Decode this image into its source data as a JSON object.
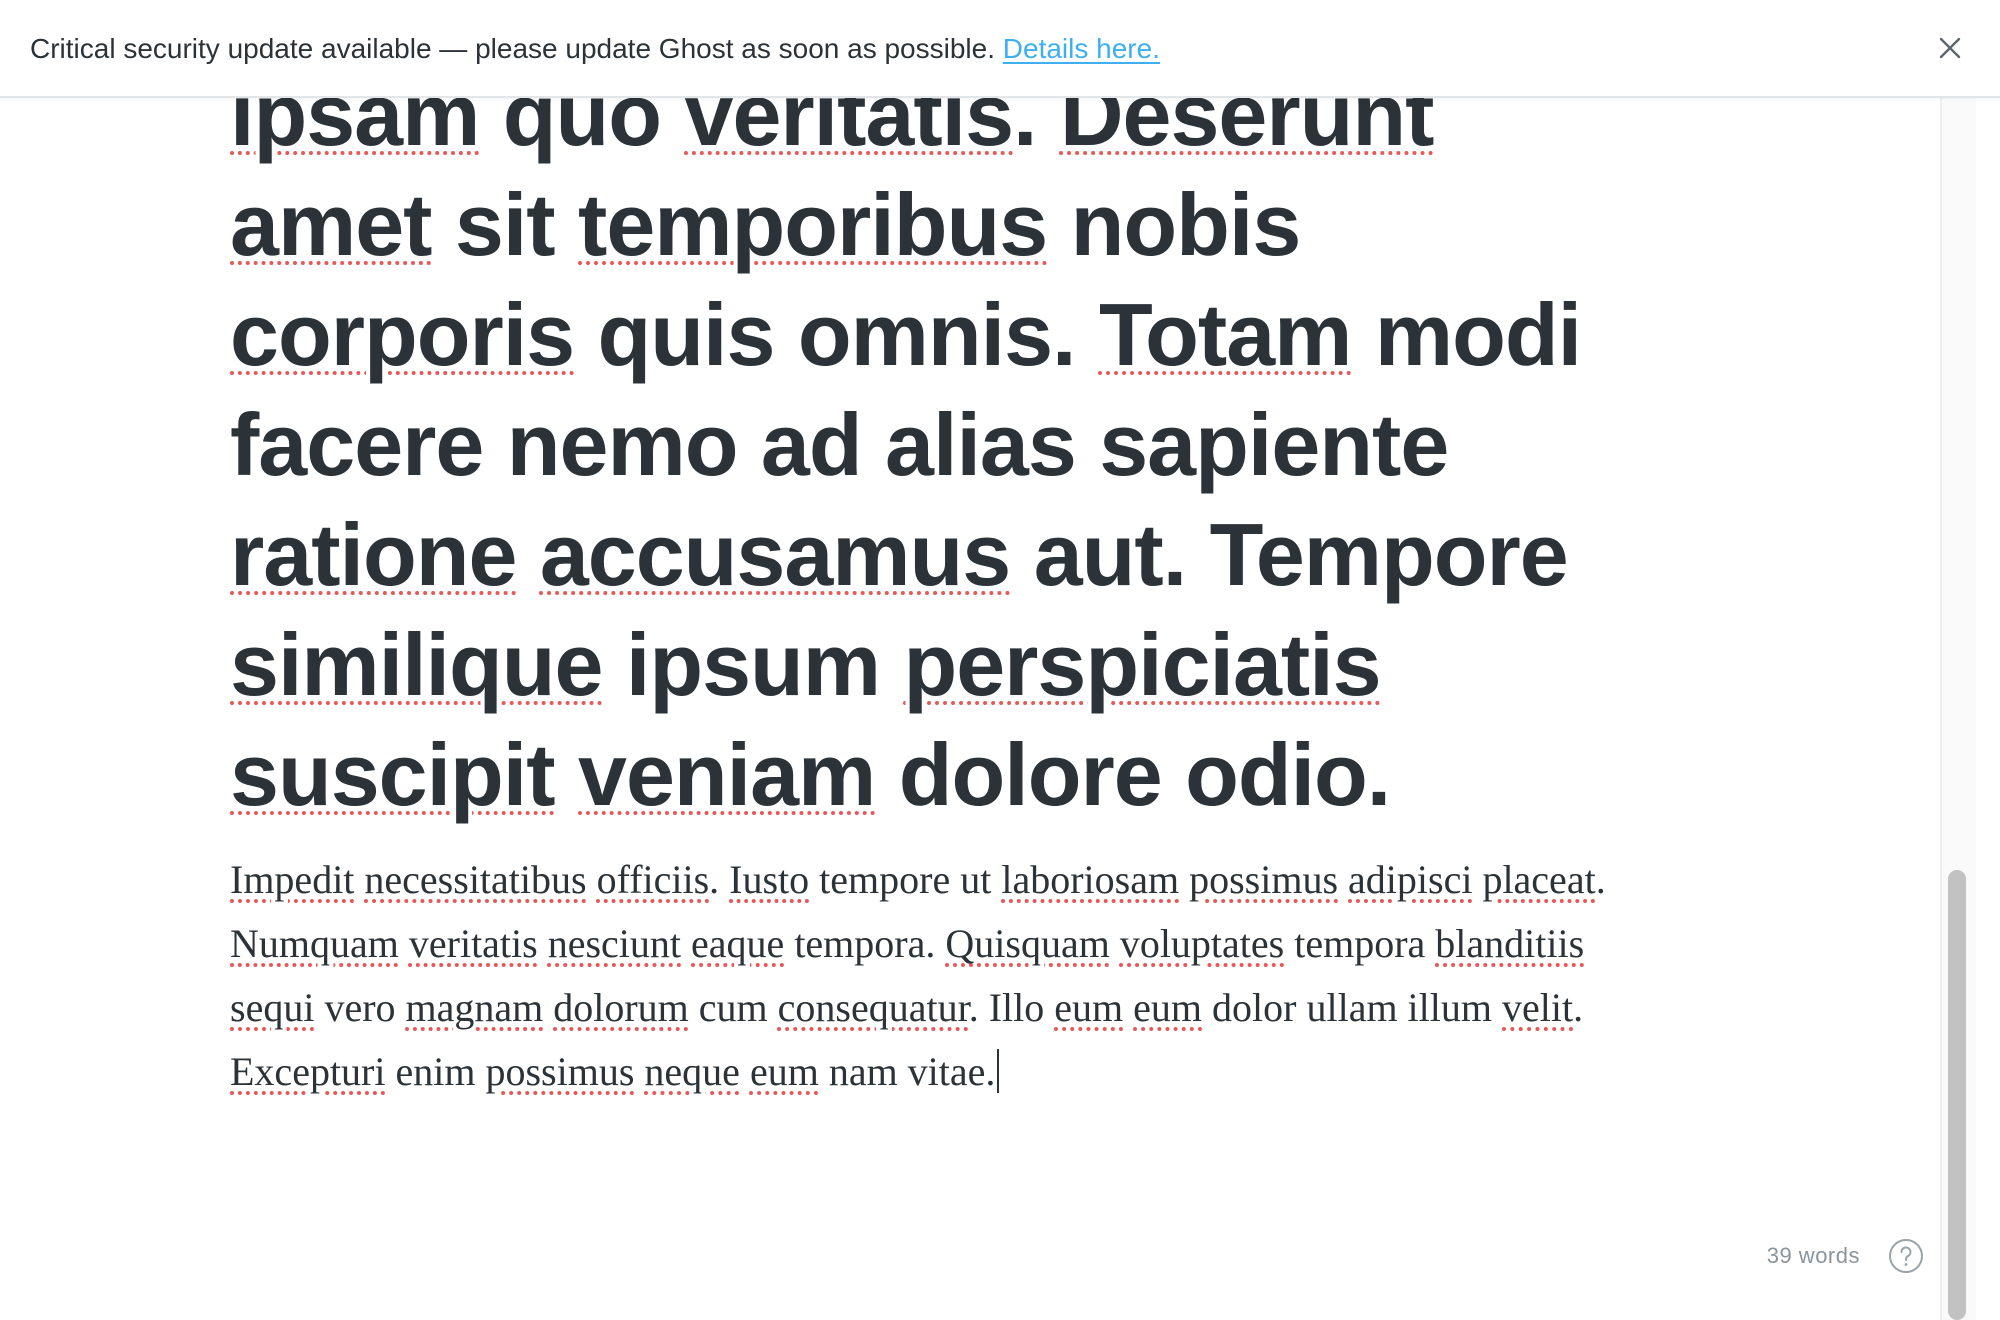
{
  "banner": {
    "message": "Critical security update available — please update Ghost as soon as possible.",
    "link_label": "Details here.",
    "link_color": "#3eb0ef"
  },
  "editor": {
    "title_segments": [
      {
        "text": "ipsam",
        "misspelled": true
      },
      {
        "text": " "
      },
      {
        "text": "quo"
      },
      {
        "text": " "
      },
      {
        "text": "veritatis",
        "misspelled": true
      },
      {
        "text": ". "
      },
      {
        "text": "Deserunt",
        "misspelled": true
      },
      {
        "text": " "
      },
      {
        "text": "amet",
        "misspelled": true
      },
      {
        "text": " sit "
      },
      {
        "text": "temporibus",
        "misspelled": true
      },
      {
        "text": " nobis "
      },
      {
        "text": "corporis",
        "misspelled": true
      },
      {
        "text": " quis omnis. "
      },
      {
        "text": "Totam",
        "misspelled": true
      },
      {
        "text": " modi facere nemo ad alias sapiente "
      },
      {
        "text": "ratione",
        "misspelled": true
      },
      {
        "text": " "
      },
      {
        "text": "accusamus",
        "misspelled": true
      },
      {
        "text": " aut. Tempore "
      },
      {
        "text": "similique",
        "misspelled": true
      },
      {
        "text": " ipsum "
      },
      {
        "text": "perspiciatis",
        "misspelled": true
      },
      {
        "text": " "
      },
      {
        "text": "suscipit",
        "misspelled": true
      },
      {
        "text": " "
      },
      {
        "text": "veniam",
        "misspelled": true
      },
      {
        "text": " dolore odio."
      }
    ],
    "body_segments": [
      {
        "text": "Impedit",
        "misspelled": true
      },
      {
        "text": " "
      },
      {
        "text": "necessitatibus",
        "misspelled": true
      },
      {
        "text": " "
      },
      {
        "text": "officiis",
        "misspelled": true
      },
      {
        "text": ". "
      },
      {
        "text": "Iusto",
        "misspelled": true
      },
      {
        "text": " tempore ut "
      },
      {
        "text": "laboriosam",
        "misspelled": true
      },
      {
        "text": " "
      },
      {
        "text": "possimus",
        "misspelled": true
      },
      {
        "text": " "
      },
      {
        "text": "adipisci",
        "misspelled": true
      },
      {
        "text": " "
      },
      {
        "text": "placeat",
        "misspelled": true
      },
      {
        "text": ". "
      },
      {
        "text": "Numquam",
        "misspelled": true
      },
      {
        "text": " "
      },
      {
        "text": "veritatis",
        "misspelled": true
      },
      {
        "text": " "
      },
      {
        "text": "nesciunt",
        "misspelled": true
      },
      {
        "text": " "
      },
      {
        "text": "eaque",
        "misspelled": true
      },
      {
        "text": " tempora. "
      },
      {
        "text": "Quisquam",
        "misspelled": true
      },
      {
        "text": " "
      },
      {
        "text": "voluptates",
        "misspelled": true
      },
      {
        "text": " tempora "
      },
      {
        "text": "blanditiis",
        "misspelled": true
      },
      {
        "text": " "
      },
      {
        "text": "sequi",
        "misspelled": true
      },
      {
        "text": " vero "
      },
      {
        "text": "magnam",
        "misspelled": true
      },
      {
        "text": " "
      },
      {
        "text": "dolorum",
        "misspelled": true
      },
      {
        "text": " cum "
      },
      {
        "text": "consequatur",
        "misspelled": true
      },
      {
        "text": ". Illo "
      },
      {
        "text": "eum",
        "misspelled": true
      },
      {
        "text": " "
      },
      {
        "text": "eum",
        "misspelled": true
      },
      {
        "text": " dolor ullam illum "
      },
      {
        "text": "velit",
        "misspelled": true
      },
      {
        "text": ". "
      },
      {
        "text": "Excepturi",
        "misspelled": true
      },
      {
        "text": " enim "
      },
      {
        "text": "possimus",
        "misspelled": true
      },
      {
        "text": " "
      },
      {
        "text": "neque",
        "misspelled": true
      },
      {
        "text": " "
      },
      {
        "text": "eum",
        "misspelled": true
      },
      {
        "text": " nam vitae."
      }
    ],
    "spellcheck_color": "#e45a5a"
  },
  "status": {
    "word_count": "39 words",
    "help_icon": "help-circle-icon"
  },
  "scrollbar": {
    "position_fraction": 0.63
  }
}
